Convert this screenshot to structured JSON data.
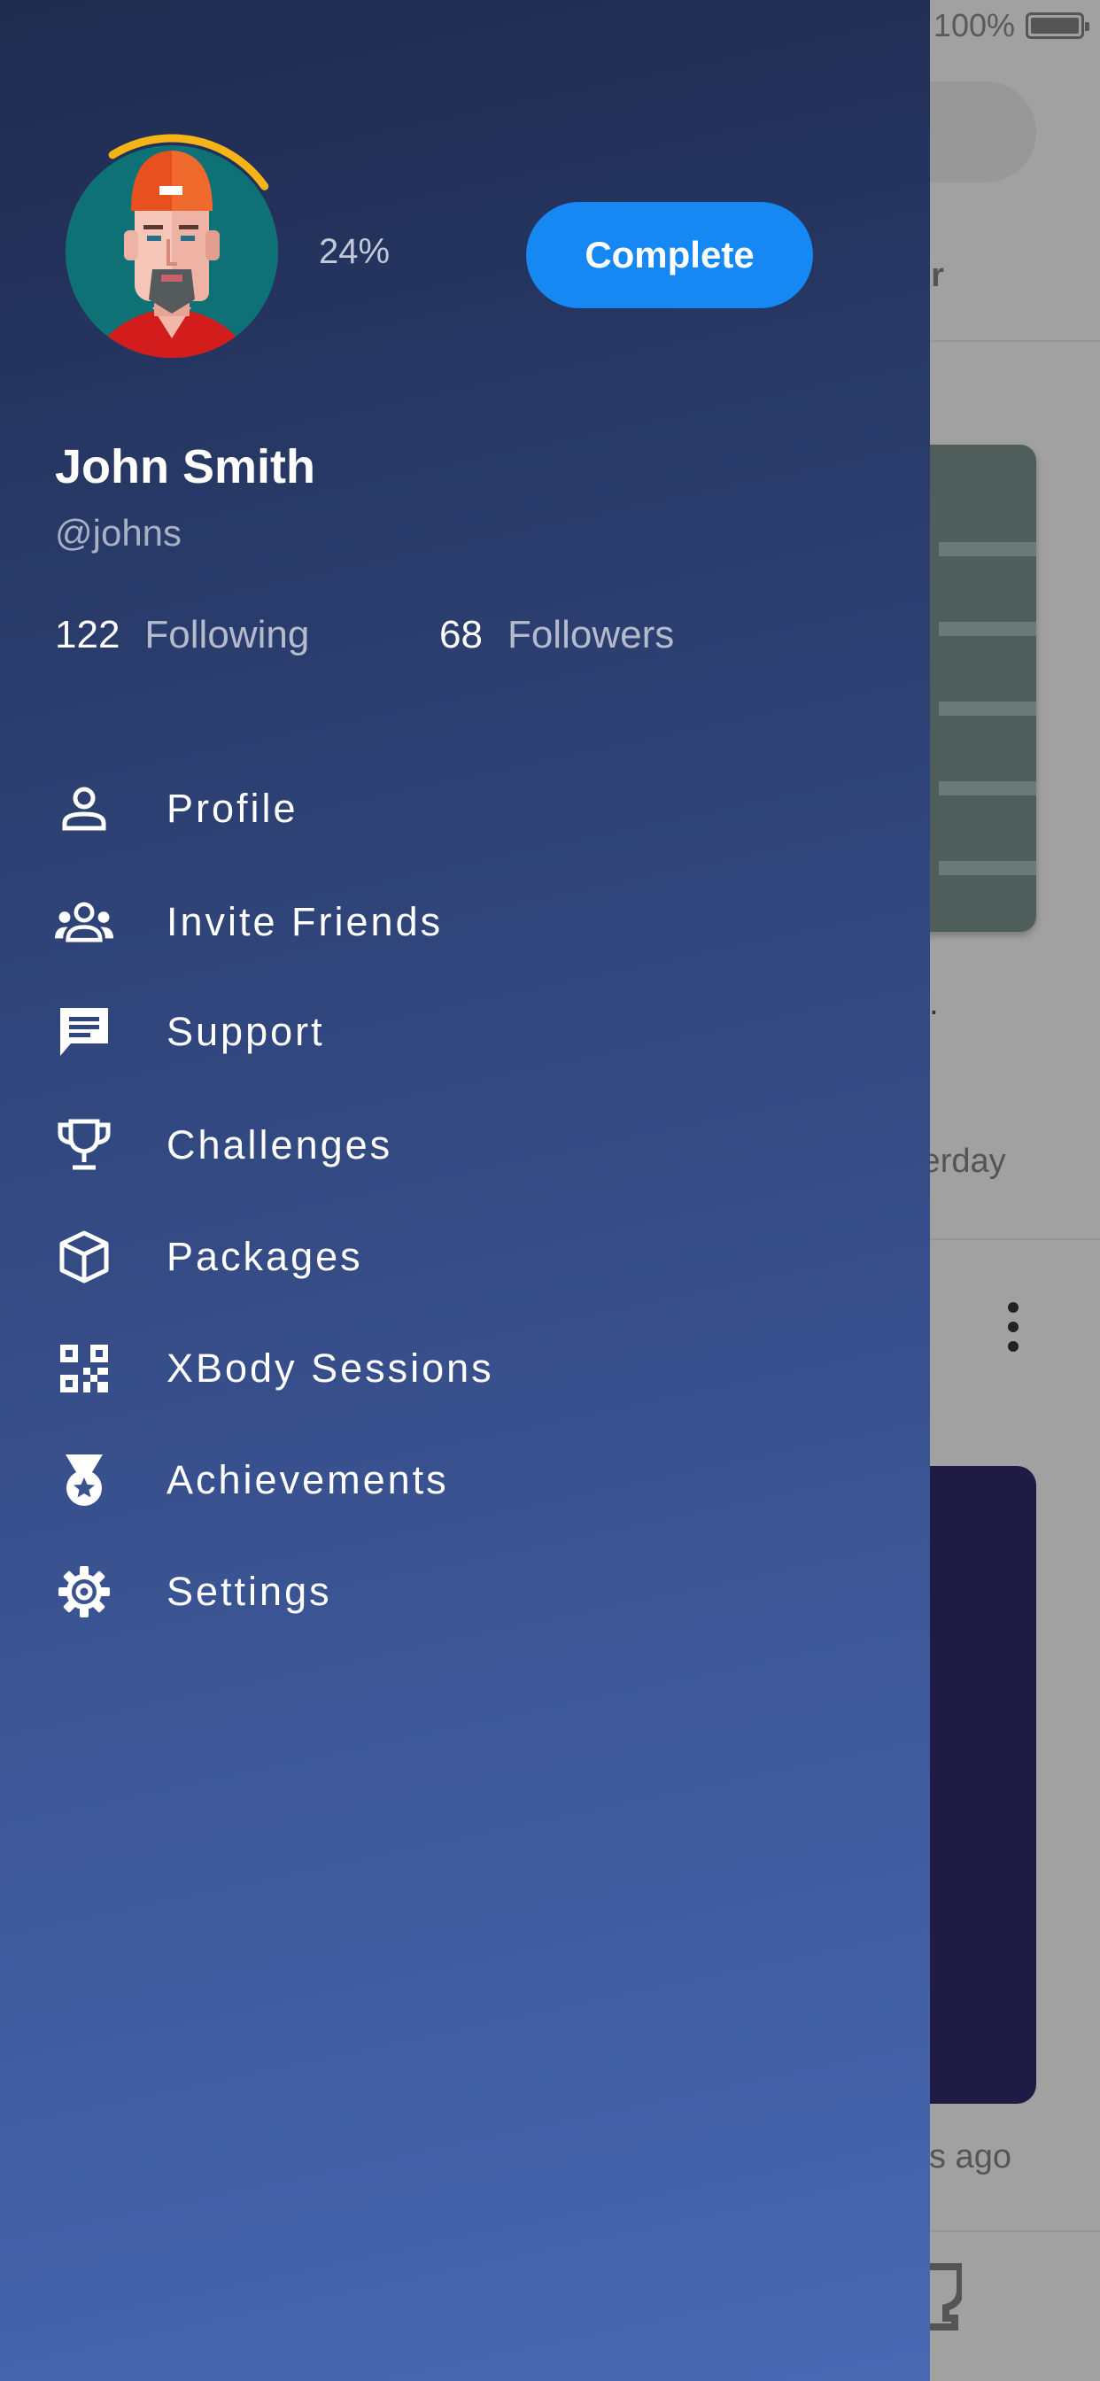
{
  "background_app": {
    "status_battery": "100%",
    "tab_fragment": "er",
    "text_fragment_1": "n.",
    "text_fragment_2": "terday",
    "text_fragment_3": "ys ago"
  },
  "drawer": {
    "profile_progress_percent": 24,
    "progress_label": "24%",
    "complete_button": "Complete",
    "user_name": "John Smith",
    "user_handle": "@johns",
    "stats": {
      "following_count": "122",
      "following_label": "Following",
      "followers_count": "68",
      "followers_label": "Followers"
    },
    "menu_items": [
      {
        "label": "Profile",
        "icon": "person-icon"
      },
      {
        "label": "Invite Friends",
        "icon": "group-icon"
      },
      {
        "label": "Support",
        "icon": "chat-icon"
      },
      {
        "label": "Challenges",
        "icon": "trophy-icon"
      },
      {
        "label": "Packages",
        "icon": "package-icon"
      },
      {
        "label": "XBody Sessions",
        "icon": "qr-code-icon"
      },
      {
        "label": "Achievements",
        "icon": "medal-icon"
      },
      {
        "label": "Settings",
        "icon": "gear-icon"
      }
    ]
  },
  "colors": {
    "accent_button": "#1588f3",
    "progress_arc": "#f7b419",
    "drawer_gradient_top": "#1f2b4f",
    "drawer_gradient_bottom": "#4868b3"
  }
}
